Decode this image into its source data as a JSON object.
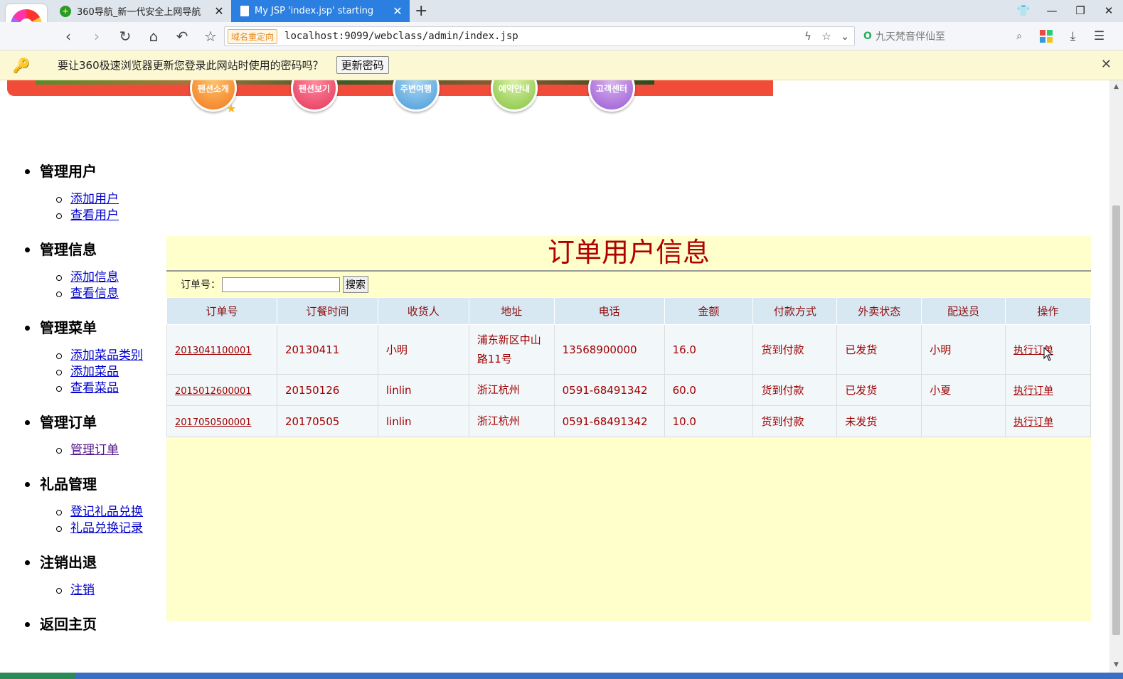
{
  "browser": {
    "tabs": [
      {
        "title": "360导航_新一代安全上网导航",
        "active": false
      },
      {
        "title": "My JSP 'index.jsp' starting",
        "active": true
      }
    ],
    "redirect_badge": "域名重定向",
    "url": "localhost:9099/webclass/admin/index.jsp",
    "search_placeholder": "九天梵音伴仙至"
  },
  "password_bar": {
    "message": "要让360极速浏览器更新您登录此网站时使用的密码吗？",
    "button_label": "更新密码"
  },
  "banner": {
    "nav": [
      "펜션소개",
      "펜션보기",
      "주변여행",
      "예약안내",
      "고객센터"
    ]
  },
  "menu": [
    {
      "title": "管理用户",
      "items": [
        {
          "label": "添加用户",
          "visited": false
        },
        {
          "label": "查看用户",
          "visited": false
        }
      ]
    },
    {
      "title": "管理信息",
      "items": [
        {
          "label": "添加信息",
          "visited": false
        },
        {
          "label": "查看信息",
          "visited": false
        }
      ]
    },
    {
      "title": "管理菜单",
      "items": [
        {
          "label": "添加菜品类别",
          "visited": false
        },
        {
          "label": "添加菜品",
          "visited": false
        },
        {
          "label": "查看菜品",
          "visited": false
        }
      ]
    },
    {
      "title": "管理订单",
      "items": [
        {
          "label": "管理订单",
          "visited": true
        }
      ]
    },
    {
      "title": "礼品管理",
      "items": [
        {
          "label": "登记礼品兑换",
          "visited": false
        },
        {
          "label": "礼品兑换记录",
          "visited": false
        }
      ]
    },
    {
      "title": "注销出退",
      "items": [
        {
          "label": "注销",
          "visited": false
        }
      ]
    },
    {
      "title": "返回主页",
      "items": []
    }
  ],
  "orders": {
    "title": "订单用户信息",
    "search_label": "订单号：",
    "search_value": "",
    "search_button": "搜索",
    "columns": [
      "订单号",
      "订餐时间",
      "收货人",
      "地址",
      "电话",
      "金额",
      "付款方式",
      "外卖状态",
      "配送员",
      "操作"
    ],
    "rows": [
      {
        "order_no": "2013041100001",
        "time": "20130411",
        "receiver": "小明",
        "address": "浦东新区中山路11号",
        "phone": "13568900000",
        "amount": "16.0",
        "payment": "货到付款",
        "status": "已发货",
        "courier": "小明",
        "action": "执行订单"
      },
      {
        "order_no": "2015012600001",
        "time": "20150126",
        "receiver": "linlin",
        "address": "浙江杭州",
        "phone": "0591-68491342",
        "amount": "60.0",
        "payment": "货到付款",
        "status": "已发货",
        "courier": "小夏",
        "action": "执行订单"
      },
      {
        "order_no": "2017050500001",
        "time": "20170505",
        "receiver": "linlin",
        "address": "浙江杭州",
        "phone": "0591-68491342",
        "amount": "10.0",
        "payment": "货到付款",
        "status": "未发货",
        "courier": "",
        "action": "执行订单"
      }
    ]
  },
  "colors": {
    "title_red": "#b10000",
    "panel_bg": "#ffffcc",
    "header_bg": "#d8e8f2",
    "active_tab": "#2a7fe0",
    "banner_red": "#f14b3a"
  }
}
